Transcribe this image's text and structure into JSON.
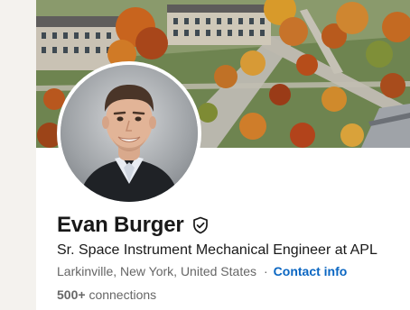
{
  "profile": {
    "name": "Evan Burger",
    "verified_icon": "shield-check-icon",
    "headline": "Sr. Space Instrument Mechanical Engineer at APL",
    "location": "Larkinville, New York, United States",
    "separator": "·",
    "contact_label": "Contact info",
    "connections_count": "500+",
    "connections_label": "connections"
  },
  "colors": {
    "accent": "#0a66c2",
    "text_primary": "#191919",
    "text_secondary": "#666666",
    "page_background": "#f4f2ee"
  }
}
